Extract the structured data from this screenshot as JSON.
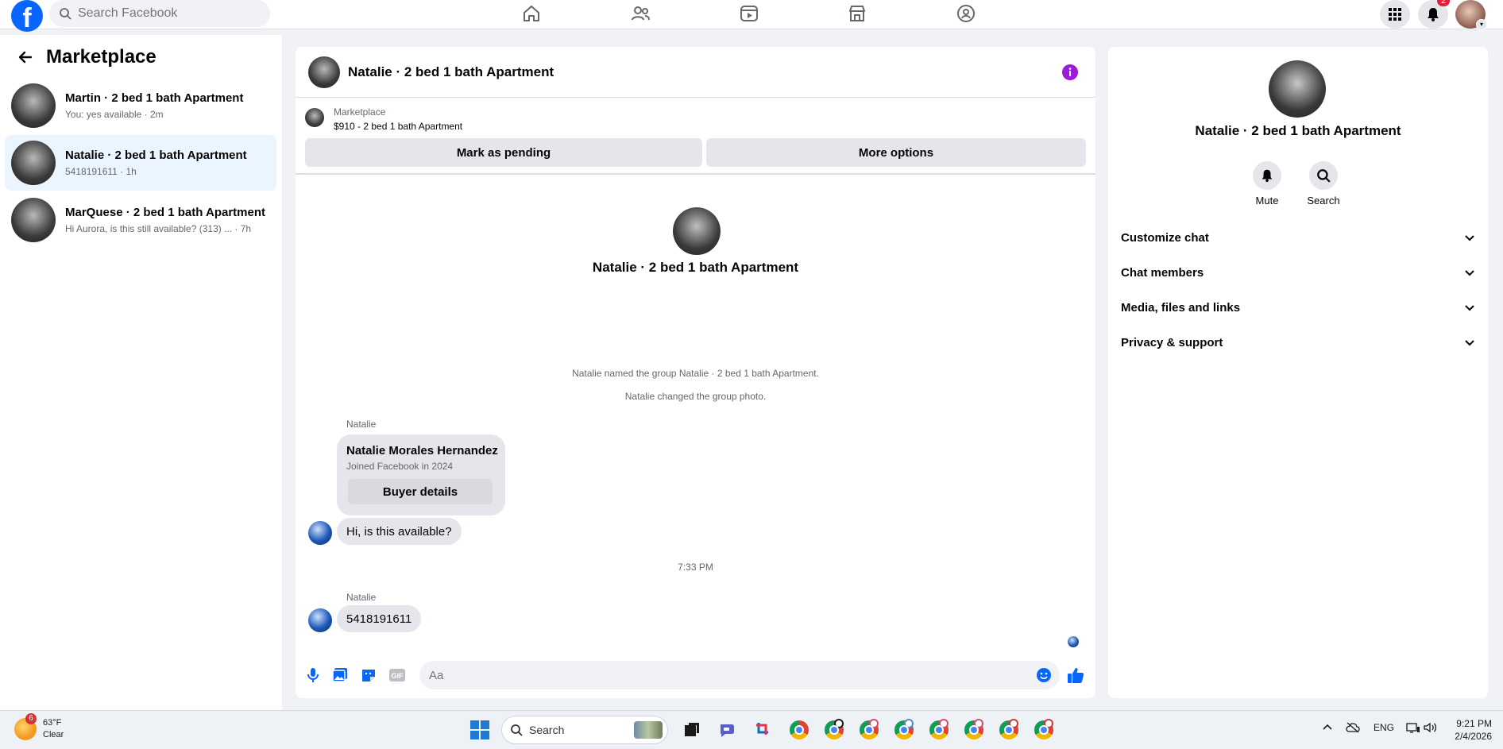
{
  "topbar": {
    "logo": "f",
    "search_placeholder": "Search Facebook",
    "nav_icons": [
      "home-icon",
      "friends-icon",
      "video-icon",
      "marketplace-icon",
      "groups-icon"
    ],
    "notifications_count": "2"
  },
  "left": {
    "title": "Marketplace",
    "conversations": [
      {
        "name": "Martin · 2 bed 1 bath Apartment",
        "sub": "You: yes available · 2m"
      },
      {
        "name": "Natalie · 2 bed 1 bath Apartment",
        "sub": "5418191611 · 1h"
      },
      {
        "name": "MarQuese · 2 bed 1 bath Apartment",
        "sub": "Hi Aurora, is this still available? (313) ... · 7h"
      }
    ]
  },
  "chat": {
    "title": "Natalie · 2 bed 1 bath Apartment",
    "listing": {
      "source": "Marketplace",
      "price_title": "$910 - 2 bed 1 bath Apartment",
      "pending_label": "Mark as pending",
      "more_label": "More options"
    },
    "hero_title": "Natalie · 2 bed 1 bath Apartment",
    "system_messages": [
      "Natalie named the group Natalie · 2 bed 1 bath Apartment.",
      "Natalie changed the group photo."
    ],
    "sender_name": "Natalie",
    "buyer_card": {
      "name": "Natalie Morales Hernandez",
      "joined": "Joined Facebook in 2024",
      "button": "Buyer details"
    },
    "message_1": "Hi, is this available?",
    "timestamp": "7:33 PM",
    "sender_name_2": "Natalie",
    "message_2": "5418191611",
    "composer_placeholder": "Aa",
    "accent": "#0866ff"
  },
  "info": {
    "title": "Natalie · 2 bed 1 bath Apartment",
    "mute_label": "Mute",
    "search_label": "Search",
    "sections": [
      "Customize chat",
      "Chat members",
      "Media, files and links",
      "Privacy & support"
    ]
  },
  "taskbar": {
    "weather_badge": "6",
    "temperature": "63°F",
    "condition": "Clear",
    "search_label": "Search",
    "language": "ENG",
    "time": "9:21 PM",
    "date": "2/4/2026"
  }
}
